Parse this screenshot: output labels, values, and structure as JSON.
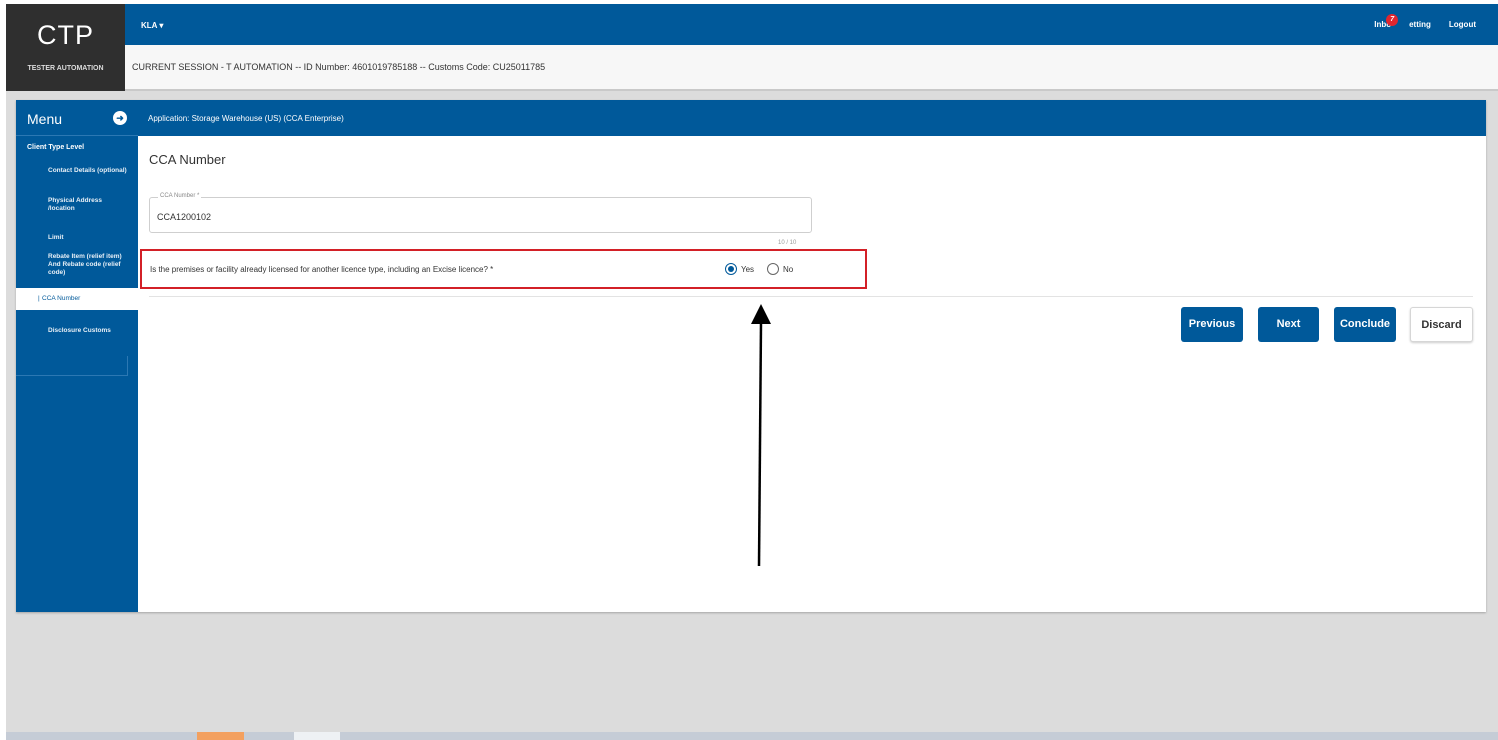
{
  "brand": {
    "title": "CTP",
    "user": "TESTER AUTOMATION"
  },
  "topbar": {
    "role": "KLA",
    "role_caret": "▾",
    "inbox_label": "Inbo",
    "inbox_badge": "7",
    "setting_label": "etting",
    "logout_label": "Logout"
  },
  "session": {
    "text": "CURRENT SESSION - T AUTOMATION -- ID Number: 4601019785188 -- Customs Code: CU25011785"
  },
  "sidebar": {
    "title": "Menu",
    "toggle_icon": "circle-arrow-icon",
    "group": "Client Type Level",
    "items": [
      {
        "label": "Contact Details (optional)"
      },
      {
        "label": "Physical Address /location"
      },
      {
        "label": "Limit"
      },
      {
        "label": "Rebate Item (relief item) And Rebate code (relief code)"
      },
      {
        "label": "CCA Number",
        "active": true
      },
      {
        "label": "Disclosure Customs"
      }
    ]
  },
  "app": {
    "title": "Application: Storage Warehouse (US) (CCA Enterprise)"
  },
  "form": {
    "heading": "CCA Number",
    "field_label": "CCA Number *",
    "field_value": "CCA1200102",
    "counter": "10 / 10",
    "question": "Is the premises or facility already licensed for another licence type, including an Excise licence? *",
    "options": [
      {
        "label": "Yes",
        "selected": true
      },
      {
        "label": "No",
        "selected": false
      }
    ]
  },
  "buttons": {
    "previous": "Previous",
    "next": "Next",
    "conclude": "Conclude",
    "discard": "Discard"
  },
  "colors": {
    "primary": "#00599a",
    "highlight": "#d32027",
    "badge": "#e0262f",
    "logo_bg": "#2f2f2f"
  }
}
